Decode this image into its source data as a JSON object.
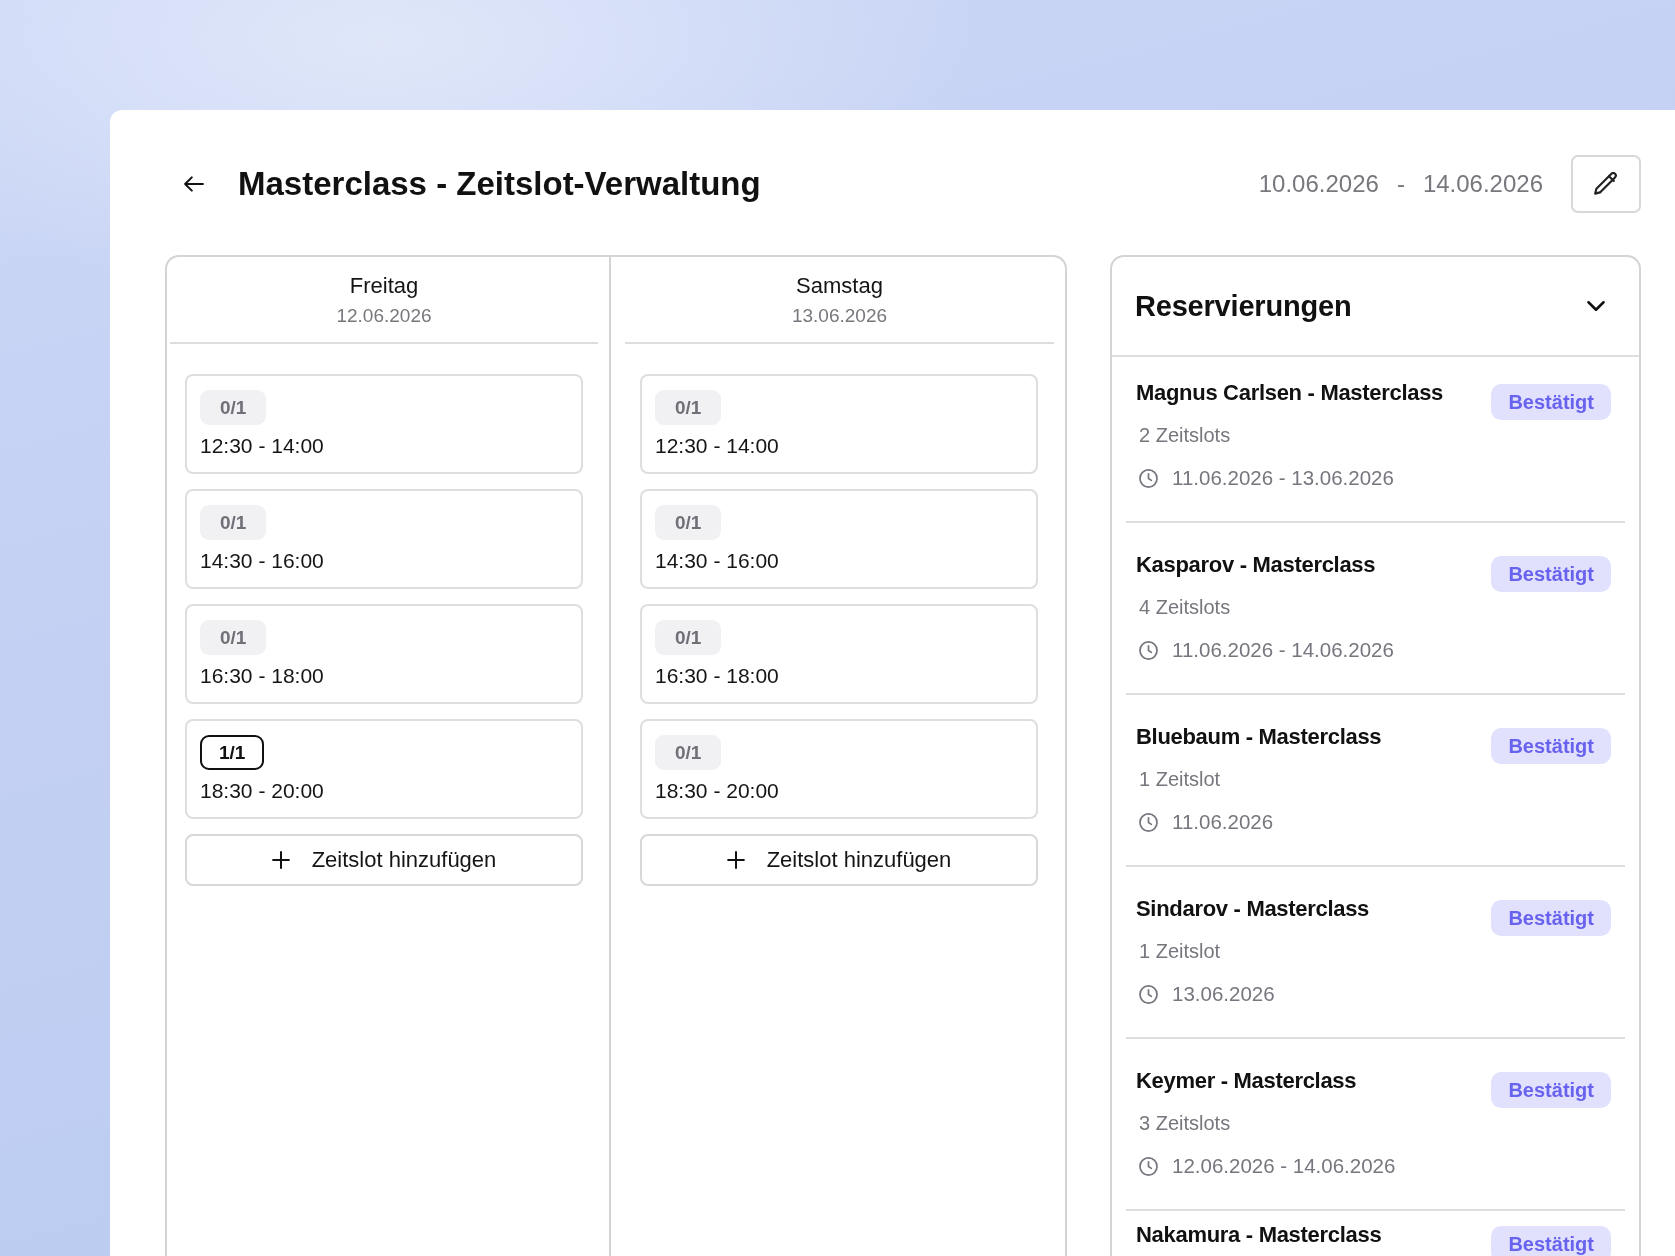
{
  "header": {
    "title": "Masterclass - Zeitslot-Verwaltung",
    "date_from": "10.06.2026",
    "date_separator": "-",
    "date_to": "14.06.2026"
  },
  "days": [
    {
      "name": "Freitag",
      "date": "12.06.2026",
      "slots": [
        {
          "occupancy": "0/1",
          "time": "12:30 - 14:00",
          "full": false
        },
        {
          "occupancy": "0/1",
          "time": "14:30 - 16:00",
          "full": false
        },
        {
          "occupancy": "0/1",
          "time": "16:30 - 18:00",
          "full": false
        },
        {
          "occupancy": "1/1",
          "time": "18:30 - 20:00",
          "full": true
        }
      ],
      "add_button": "Zeitslot hinzufügen"
    },
    {
      "name": "Samstag",
      "date": "13.06.2026",
      "slots": [
        {
          "occupancy": "0/1",
          "time": "12:30 - 14:00",
          "full": false
        },
        {
          "occupancy": "0/1",
          "time": "14:30 - 16:00",
          "full": false
        },
        {
          "occupancy": "0/1",
          "time": "16:30 - 18:00",
          "full": false
        },
        {
          "occupancy": "0/1",
          "time": "18:30 - 20:00",
          "full": false
        }
      ],
      "add_button": "Zeitslot hinzufügen"
    }
  ],
  "reservations": {
    "title": "Reservierungen",
    "items": [
      {
        "title": "Magnus Carlsen - Masterclass",
        "status": "Bestätigt",
        "slot_count": "2 Zeitslots",
        "dates": "11.06.2026 - 13.06.2026"
      },
      {
        "title": "Kasparov - Masterclass",
        "status": "Bestätigt",
        "slot_count": "4 Zeitslots",
        "dates": "11.06.2026 - 14.06.2026"
      },
      {
        "title": "Bluebaum - Masterclass",
        "status": "Bestätigt",
        "slot_count": "1 Zeitslot",
        "dates": "11.06.2026"
      },
      {
        "title": "Sindarov - Masterclass",
        "status": "Bestätigt",
        "slot_count": "1 Zeitslot",
        "dates": "13.06.2026"
      },
      {
        "title": "Keymer - Masterclass",
        "status": "Bestätigt",
        "slot_count": "3 Zeitslots",
        "dates": "12.06.2026 - 14.06.2026"
      },
      {
        "title": "Nakamura - Masterclass",
        "status": "Bestätigt"
      }
    ]
  }
}
